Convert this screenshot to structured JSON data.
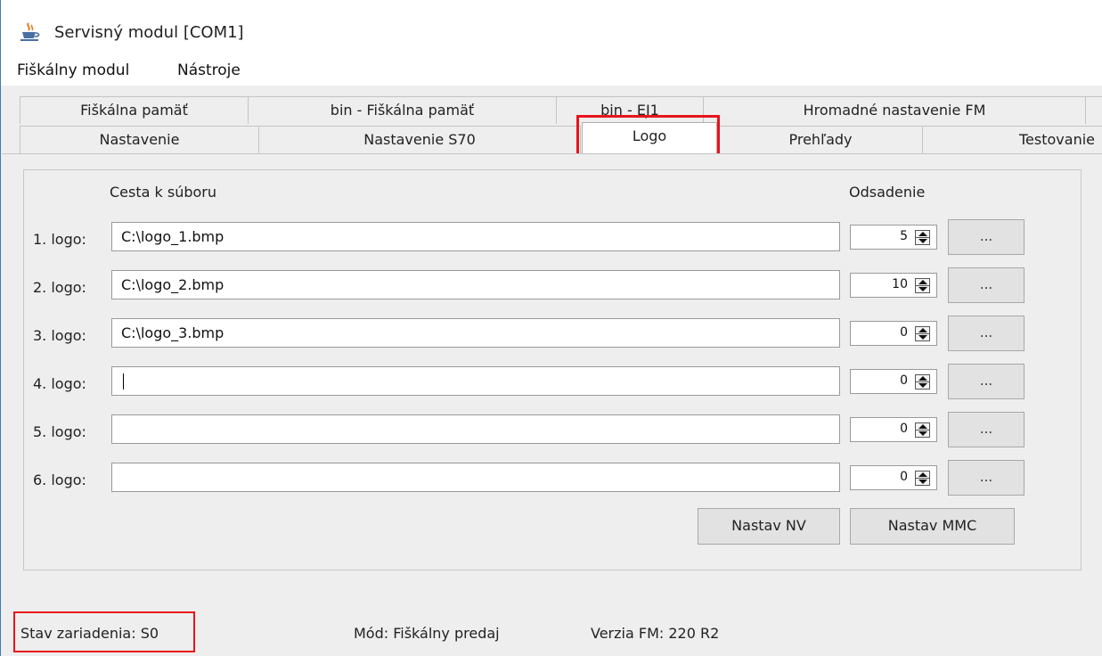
{
  "window": {
    "title": "Servisný modul [COM1]",
    "icon": "java-cup-icon"
  },
  "menu": [
    "Fiškálny modul",
    "Nástroje"
  ],
  "tabs": {
    "row_back": [
      "Fiškálna pamäť",
      "bin - Fiškálna pamäť",
      "bin - EJ1",
      "Hromadné nastavenie FM"
    ],
    "row_front": [
      "Nastavenie",
      "Nastavenie S70",
      "Logo",
      "Prehľady",
      "Testovanie"
    ],
    "selected": "Logo"
  },
  "logo_panel": {
    "path_header": "Cesta k súboru",
    "offset_header": "Odsadenie",
    "browse_label": "...",
    "rows": [
      {
        "label": "1. logo:",
        "path": "C:\\logo_1.bmp",
        "offset": "5"
      },
      {
        "label": "2. logo:",
        "path": "C:\\logo_2.bmp",
        "offset": "10"
      },
      {
        "label": "3. logo:",
        "path": "C:\\logo_3.bmp",
        "offset": "0"
      },
      {
        "label": "4. logo:",
        "path": "",
        "offset": "0"
      },
      {
        "label": "5. logo:",
        "path": "",
        "offset": "0"
      },
      {
        "label": "6. logo:",
        "path": "",
        "offset": "0"
      }
    ],
    "buttons": {
      "set_nv": "Nastav NV",
      "set_mmc": "Nastav MMC"
    }
  },
  "status": {
    "device_state": "Stav zariadenia: S0",
    "mode": "Mód: Fiškálny predaj",
    "fm_version": "Verzia FM: 220 R2"
  },
  "colors": {
    "highlight": "#e8141c",
    "window_border": "#3c7fb1"
  }
}
